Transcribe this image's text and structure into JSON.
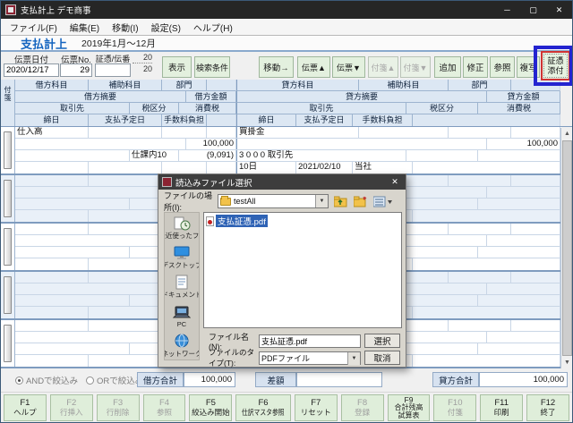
{
  "window": {
    "title": "支払計上 デモ商事"
  },
  "icons": {
    "minimize": "─",
    "maximize": "▢",
    "close": "✕",
    "dropdown": "▼",
    "scroll_up": "▲",
    "scroll_down": "▼"
  },
  "menu": {
    "items": [
      "ファイル(F)",
      "編集(E)",
      "移動(I)",
      "設定(S)",
      "ヘルプ(H)"
    ]
  },
  "page": {
    "title": "支払計上",
    "period": "2019年1月～12月"
  },
  "controls": {
    "slip_date": {
      "label": "伝票日付",
      "value": "2020/12/17"
    },
    "slip_no": {
      "label": "伝票No.",
      "value": "29"
    },
    "voucher": {
      "label": "証憑/伝番",
      "value": ""
    },
    "count": {
      "top": "20",
      "bottom": "20"
    },
    "display": "表示",
    "search": "検索条件",
    "move": "移動→",
    "slip_up": "伝票▲",
    "slip_down": "伝票▼",
    "fusen_up": "付箋▲",
    "fusen_down": "付箋▼",
    "add": "追加",
    "modify": "修正",
    "refer": "参照",
    "copy": "複写",
    "attach": {
      "line1": "証憑",
      "line2": "添付"
    }
  },
  "table": {
    "fusen": "付箋",
    "debit": {
      "account": "借方科目",
      "sub_account": "補助科目",
      "dept": "部門",
      "summary": "借方摘要",
      "amount": "借方金額",
      "vendor": "取引先",
      "tax_class": "税区分",
      "tax": "消費税",
      "closing": "締日",
      "due": "支払予定日",
      "fee": "手数料負担"
    },
    "credit": {
      "account": "貸方科目",
      "sub_account": "補助科目",
      "dept": "部門",
      "summary": "貸方摘要",
      "amount": "貸方金額",
      "vendor": "取引先",
      "tax_class": "税区分",
      "tax": "消費税",
      "closing": "締日",
      "due": "支払予定日",
      "fee": "手数料負担"
    },
    "row1": {
      "debit": {
        "account": "仕入高",
        "amount": "100,000",
        "tax_class": "仕課内10",
        "tax": "(9,091)"
      },
      "credit": {
        "account": "買掛金",
        "amount": "100,000",
        "vendor": "3 0 0 0 取引先",
        "closing": "10日",
        "due": "2021/02/10",
        "fee": "当社"
      }
    }
  },
  "dialog": {
    "title": "読込みファイル選択",
    "location": {
      "label": "ファイルの場所(I):",
      "value": "testAll"
    },
    "sidebar": [
      {
        "label": "最近使ったフ..."
      },
      {
        "label": "デスクトップ"
      },
      {
        "label": "ドキュメント"
      },
      {
        "label": "PC"
      },
      {
        "label": "ネットワーク"
      }
    ],
    "file_item": "支払証憑.pdf",
    "file_name": {
      "label": "ファイル名(N):",
      "value": "支払証憑.pdf"
    },
    "file_type": {
      "label": "ファイルのタイプ(T):",
      "value": "PDFファイル"
    },
    "select": "選択",
    "cancel": "取消"
  },
  "totals": {
    "and_filter": "ANDで絞込み",
    "or_filter": "ORで絞込み",
    "debit_total": {
      "label": "借方合計",
      "value": "100,000"
    },
    "diff": {
      "label": "差額",
      "value": ""
    },
    "credit_total": {
      "label": "貸方合計",
      "value": "100,000"
    }
  },
  "fkeys": [
    {
      "key": "F1",
      "label": "ヘルプ",
      "enabled": true
    },
    {
      "key": "F2",
      "label": "行挿入",
      "enabled": false
    },
    {
      "key": "F3",
      "label": "行削除",
      "enabled": false
    },
    {
      "key": "F4",
      "label": "参照",
      "enabled": false
    },
    {
      "key": "F5",
      "label": "絞込み開始",
      "enabled": true
    },
    {
      "key": "F6",
      "label": "仕訳マスタ参照",
      "enabled": true
    },
    {
      "key": "F7",
      "label": "リセット",
      "enabled": true
    },
    {
      "key": "F8",
      "label": "登録",
      "enabled": false
    },
    {
      "key": "F9",
      "label": "合計残高",
      "label2": "試算表",
      "enabled": true
    },
    {
      "key": "F10",
      "label": "付箋",
      "enabled": false
    },
    {
      "key": "F11",
      "label": "印刷",
      "enabled": true
    },
    {
      "key": "F12",
      "label": "終了",
      "enabled": true
    }
  ],
  "colors": {
    "accent_blue": "#1565c0",
    "annotation_blue": "#2424d0",
    "annotation_red": "#cf3434",
    "selection_blue": "#2f63b5",
    "button_green": "#e3f0de",
    "header_blue": "#dce7f3"
  }
}
